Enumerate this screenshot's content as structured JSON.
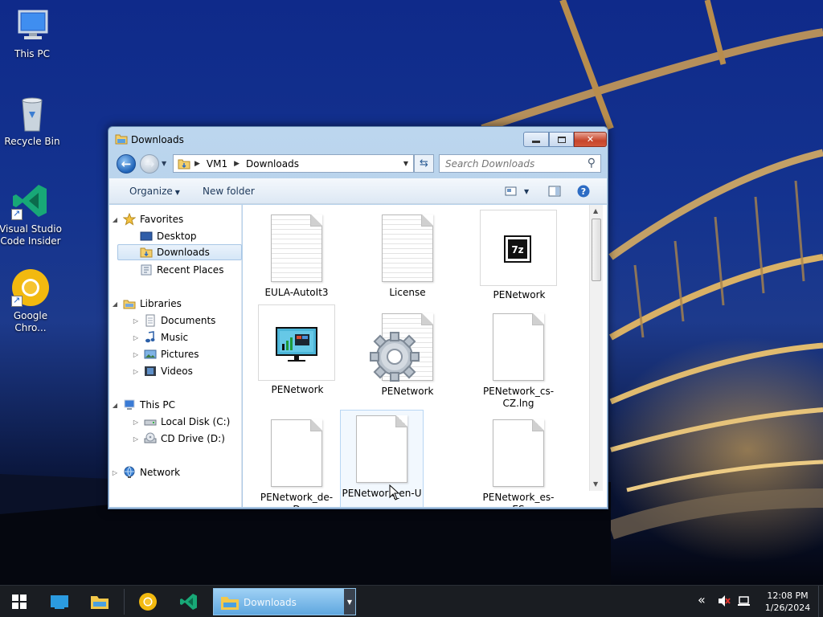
{
  "desktop": {
    "icons": [
      {
        "label": "This PC"
      },
      {
        "label": "Recycle Bin"
      },
      {
        "label": "Visual Studio Code Insider"
      },
      {
        "label": "Google Chro..."
      }
    ]
  },
  "window": {
    "title": "Downloads",
    "address": {
      "crumbs": [
        "VM1",
        "Downloads"
      ]
    },
    "search": {
      "placeholder": "Search Downloads"
    },
    "commands": {
      "organize": "Organize",
      "new_folder": "New folder"
    },
    "nav": {
      "favorites": "Favorites",
      "desktop": "Desktop",
      "downloads": "Downloads",
      "recent_places": "Recent Places",
      "libraries": "Libraries",
      "documents": "Documents",
      "music": "Music",
      "pictures": "Pictures",
      "videos": "Videos",
      "this_pc": "This PC",
      "local_disk": "Local Disk (C:)",
      "cd_drive": "CD Drive (D:)",
      "network": "Network"
    },
    "files": [
      {
        "name": "EULA-AutoIt3",
        "kind": "text-document"
      },
      {
        "name": "License",
        "kind": "text-document"
      },
      {
        "name": "PENetwork",
        "kind": "7z-archive"
      },
      {
        "name": "PENetwork",
        "kind": "application"
      },
      {
        "name": "PENetwork",
        "kind": "config-settings"
      },
      {
        "name": "PENetwork_cs-CZ.lng",
        "kind": "blank-file"
      },
      {
        "name": "PENetwork_de-D",
        "kind": "blank-file"
      },
      {
        "name": "PENetwork_en-U",
        "kind": "blank-file"
      },
      {
        "name": "PENetwork_es-ES",
        "kind": "blank-file"
      }
    ]
  },
  "taskbar": {
    "task_label": "Downloads",
    "clock_time": "12:08 PM",
    "clock_date": "1/26/2024"
  },
  "colors": {
    "window_frame": "#bcd6ee",
    "taskbar": "#1a1d22",
    "active_task": "#5fa7df",
    "close_button": "#c7452b"
  }
}
